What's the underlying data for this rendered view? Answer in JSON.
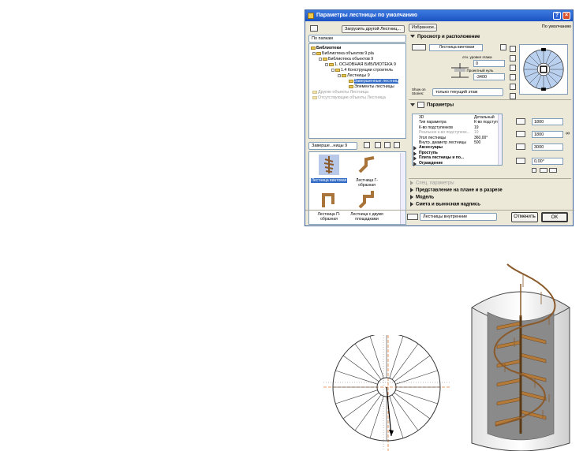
{
  "window": {
    "title": "Параметры лестницы по умолчанию",
    "help_label": "?",
    "close_label": "×"
  },
  "library": {
    "load_button": "Загрузить другой Лестниц...",
    "view_dropdown": "По папкам",
    "tree": [
      {
        "label": "Библиотеки",
        "state": "normal"
      },
      {
        "label": "Библиотека объектов 9.pla",
        "state": "normal"
      },
      {
        "label": "Библиотека объектов 9",
        "state": "normal"
      },
      {
        "label": "1. ОСНОВНАЯ БИБЛИОТЕКА 9",
        "state": "normal"
      },
      {
        "label": "1.4 Конструкции строитель",
        "state": "normal"
      },
      {
        "label": "Лестницы 9",
        "state": "normal"
      },
      {
        "label": "Завершенные лестниц",
        "state": "selected"
      },
      {
        "label": "Элементы лестницы",
        "state": "normal"
      },
      {
        "label": "Другие объекты Лестница",
        "state": "gray"
      },
      {
        "label": "Отсутствующие объекты Лестница",
        "state": "gray"
      }
    ],
    "folder_dropdown": "Заверше...ницы 9",
    "items": [
      {
        "label": "Лестница винтовая",
        "selected": true
      },
      {
        "label": "Лестница Г-образная",
        "selected": false
      },
      {
        "label": "Лестница П-образная",
        "selected": false
      },
      {
        "label": "Лестница с двумя площадками",
        "selected": false
      }
    ]
  },
  "header": {
    "favorites_button": "Избранное...",
    "default_label": "По умолчанию"
  },
  "preview": {
    "section_title": "Просмотр и расположение",
    "stair_name": "Лестница винтовая",
    "rel_story_label": "отн. уровня этажа",
    "rel_story_value": "0",
    "rel_project_label": "отн. Проектный нуль",
    "rel_project_value": "-3400",
    "show_on_label": "Show on Stories:",
    "show_on_value": "только текущий этаж"
  },
  "params": {
    "section_title": "Параметры",
    "rows": [
      {
        "name": "3D",
        "value": "Детальный",
        "style": "normal"
      },
      {
        "name": "Тип параметра",
        "value": "К-во подступе",
        "style": "normal"
      },
      {
        "name": "К-во подступенков",
        "value": "19",
        "style": "normal"
      },
      {
        "name": "Реальное к-во подступенк...",
        "value": "19",
        "style": "gray"
      },
      {
        "name": "Угол лестницы",
        "value": "360,00°",
        "style": "normal"
      },
      {
        "name": "Внутр. диаметр лестницы",
        "value": "500",
        "style": "normal"
      },
      {
        "name": "Аксессуары",
        "value": "",
        "style": "bold"
      },
      {
        "name": "Проступь",
        "value": "",
        "style": "bold"
      },
      {
        "name": "Плита лестницы и по...",
        "value": "",
        "style": "bold"
      },
      {
        "name": "Ограждение",
        "value": "",
        "style": "bold"
      }
    ],
    "width_value": "1800",
    "depth_value": "1800",
    "height_value": "3000",
    "angle_value": "0,00°"
  },
  "sections": [
    {
      "label": "Спец. параметры",
      "enabled": false
    },
    {
      "label": "Представление на плане и в разрезе",
      "enabled": true
    },
    {
      "label": "Модель",
      "enabled": true
    },
    {
      "label": "Смета и выносная надпись",
      "enabled": true
    }
  ],
  "footer": {
    "layer_value": "Лестницы внутренние",
    "cancel_button": "Отменить",
    "ok_button": "OK"
  }
}
